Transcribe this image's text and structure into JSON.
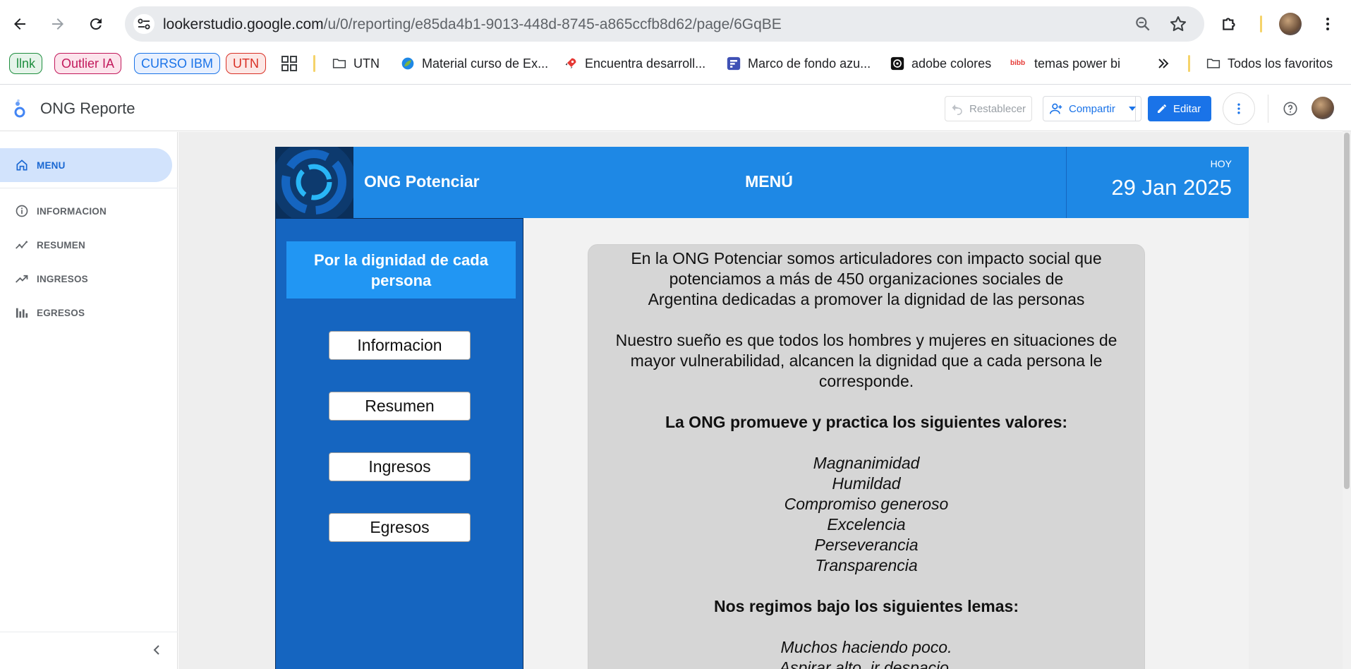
{
  "browser": {
    "url_host": "lookerstudio.google.com",
    "url_path": "/u/0/reporting/e85da4b1-9013-448d-8745-a865ccfb8d62/page/6GqBE",
    "bookmarks": [
      {
        "label": "llnk",
        "color": "#1e8e3e"
      },
      {
        "label": "Outlier IA",
        "color": "#c2185b"
      },
      {
        "label": "CURSO IBM",
        "color": "#1a73e8"
      },
      {
        "label": "UTN",
        "color": "#d93025"
      },
      {
        "label": "UTN",
        "icon": "folder-icon"
      },
      {
        "label": "Material curso de Ex...",
        "icon": "leaf-icon"
      },
      {
        "label": "Encuentra desarroll...",
        "icon": "rocket-icon"
      },
      {
        "label": "Marco de fondo azu...",
        "icon": "form-icon"
      },
      {
        "label": "adobe colores",
        "icon": "color-wheel-icon"
      },
      {
        "label": "temas power bi",
        "icon": "bibb-icon"
      },
      {
        "label": "Todos los favoritos",
        "icon": "folder-icon"
      }
    ]
  },
  "app": {
    "title": "ONG Reporte",
    "reset_label": "Restablecer",
    "share_label": "Compartir",
    "edit_label": "Editar"
  },
  "nav": {
    "items": [
      {
        "label": "MENU",
        "icon": "home-icon",
        "active": true
      },
      {
        "label": "INFORMACION",
        "icon": "info-icon"
      },
      {
        "label": "RESUMEN",
        "icon": "timeline-icon"
      },
      {
        "label": "INGRESOS",
        "icon": "trending-up-icon"
      },
      {
        "label": "EGRESOS",
        "icon": "bar-chart-icon"
      }
    ]
  },
  "report": {
    "org_name": "ONG Potenciar",
    "page_title": "MENÚ",
    "today_label": "HOY",
    "date": "29 Jan 2025",
    "motto": "Por la dignidad de cada persona",
    "buttons": [
      "Informacion",
      "Resumen",
      "Ingresos",
      "Egresos"
    ],
    "text": {
      "p1_l1": "En la ONG Potenciar somos articuladores con impacto social que",
      "p1_l2": "potenciamos a más de 450 organizaciones sociales de",
      "p1_l3": "Argentina dedicadas a promover la dignidad de las personas",
      "p2_l1": "Nuestro sueño es que todos los hombres y mujeres en situaciones de",
      "p2_l2": "mayor vulnerabilidad, alcancen la dignidad que a cada persona le",
      "p2_l3": "corresponde.",
      "values_heading": "La ONG promueve y practica los siguientes valores:",
      "values": [
        "Magnanimidad",
        "Humildad",
        "Compromiso generoso",
        "Excelencia",
        "Perseverancia",
        "Transparencia"
      ],
      "mottos_heading": "Nos regimos bajo los siguientes lemas:",
      "mottos": [
        "Muchos haciendo poco.",
        "Aspirar alto, ir despacio."
      ]
    }
  }
}
